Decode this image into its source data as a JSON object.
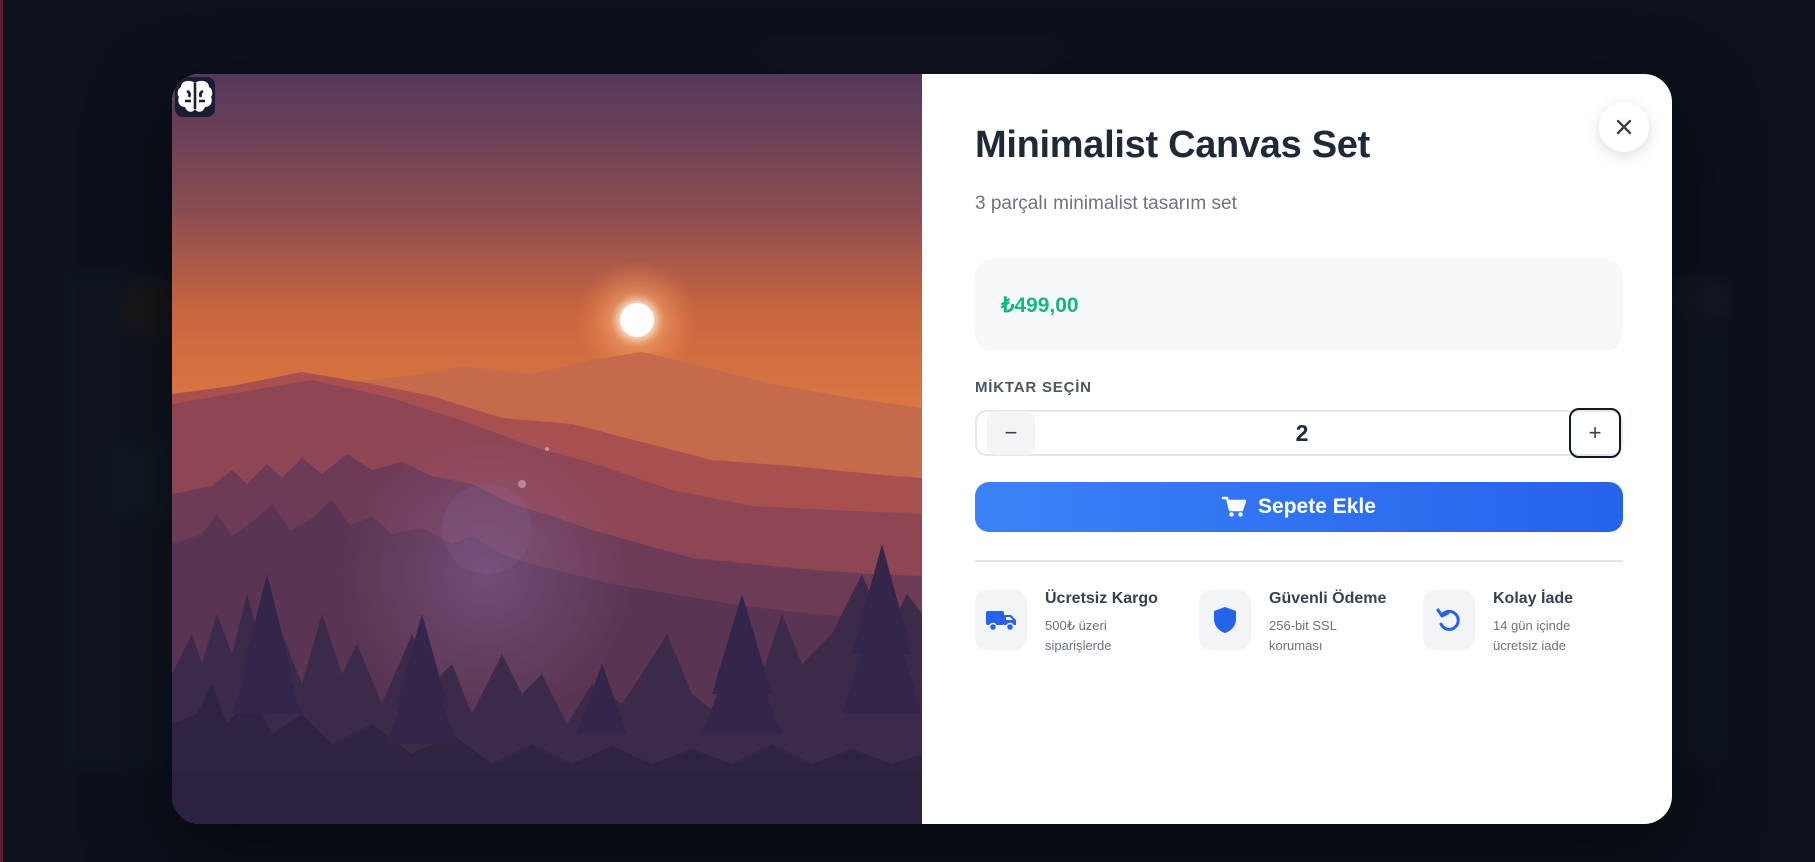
{
  "product": {
    "title": "Minimalist Canvas Set",
    "subtitle": "3 parçalı minimalist tasarım set",
    "price": "₺499,00"
  },
  "quantity": {
    "label": "MİKTAR SEÇİN",
    "minus": "−",
    "value": "2",
    "plus": "+"
  },
  "actions": {
    "add_to_cart": "Sepete Ekle",
    "close_icon": "close-icon",
    "cart_icon": "cart-icon",
    "brain_icon": "brain-icon"
  },
  "features": [
    {
      "icon": "truck-icon",
      "title": "Ücretsiz Kargo",
      "desc": "500₺ üzeri siparişlerde"
    },
    {
      "icon": "shield-icon",
      "title": "Güvenli Ödeme",
      "desc": "256-bit SSL koruması"
    },
    {
      "icon": "return-icon",
      "title": "Kolay İade",
      "desc": "14 gün içinde ücretsiz iade"
    }
  ],
  "colors": {
    "accent": "#3b82f6",
    "price": "#10b981",
    "page_background": "#121826"
  }
}
